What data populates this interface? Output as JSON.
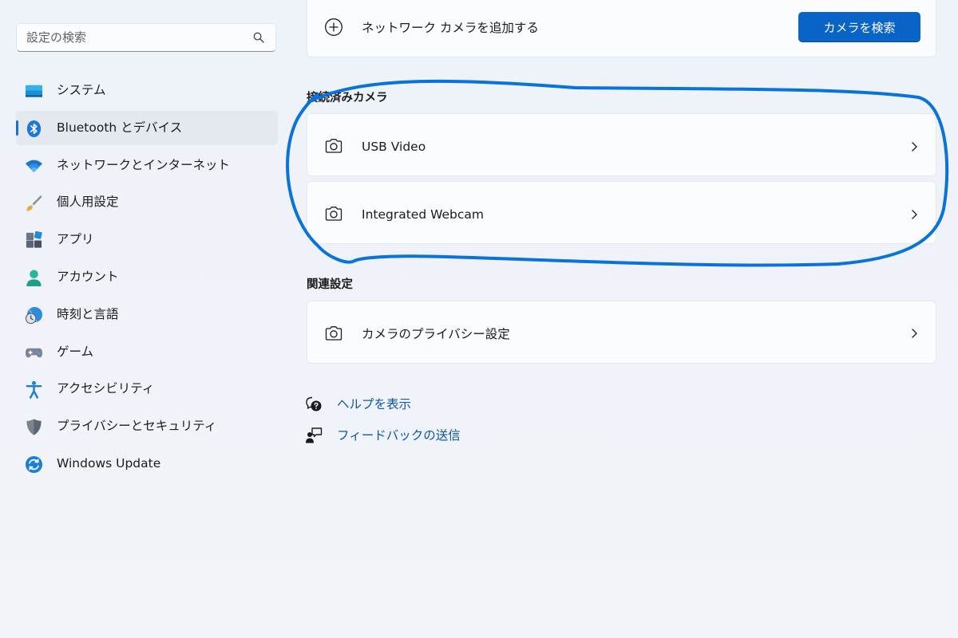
{
  "sidebar": {
    "search": {
      "placeholder": "設定の検索"
    },
    "items": [
      {
        "label": "システム",
        "icon": "system-display-icon",
        "active": false
      },
      {
        "label": "Bluetooth とデバイス",
        "icon": "bluetooth-icon",
        "active": true
      },
      {
        "label": "ネットワークとインターネット",
        "icon": "wifi-icon",
        "active": false
      },
      {
        "label": "個人用設定",
        "icon": "paintbrush-icon",
        "active": false
      },
      {
        "label": "アプリ",
        "icon": "apps-icon",
        "active": false
      },
      {
        "label": "アカウント",
        "icon": "account-icon",
        "active": false
      },
      {
        "label": "時刻と言語",
        "icon": "time-language-icon",
        "active": false
      },
      {
        "label": "ゲーム",
        "icon": "gamepad-icon",
        "active": false
      },
      {
        "label": "アクセシビリティ",
        "icon": "accessibility-icon",
        "active": false
      },
      {
        "label": "プライバシーとセキュリティ",
        "icon": "shield-icon",
        "active": false
      },
      {
        "label": "Windows Update",
        "icon": "windows-update-icon",
        "active": false
      }
    ]
  },
  "main": {
    "add_network_camera": {
      "label": "ネットワーク カメラを追加する",
      "icon": "plus-circle-icon",
      "button_label": "カメラを検索"
    },
    "connected_cameras": {
      "title": "接続済みカメラ",
      "items": [
        {
          "label": "USB Video",
          "icon": "camera-icon"
        },
        {
          "label": "Integrated Webcam",
          "icon": "camera-icon"
        }
      ]
    },
    "related_settings": {
      "title": "関連設定",
      "items": [
        {
          "label": "カメラのプライバシー設定",
          "icon": "camera-icon"
        }
      ]
    },
    "links": {
      "help": {
        "label": "ヘルプを表示",
        "icon": "help-icon"
      },
      "feedback": {
        "label": "フィードバックの送信",
        "icon": "feedback-icon"
      }
    }
  },
  "colors": {
    "accent": "#0a63c6",
    "link": "#0a56b0",
    "annotation": "#0a73d9",
    "background": "#eef2f8"
  }
}
